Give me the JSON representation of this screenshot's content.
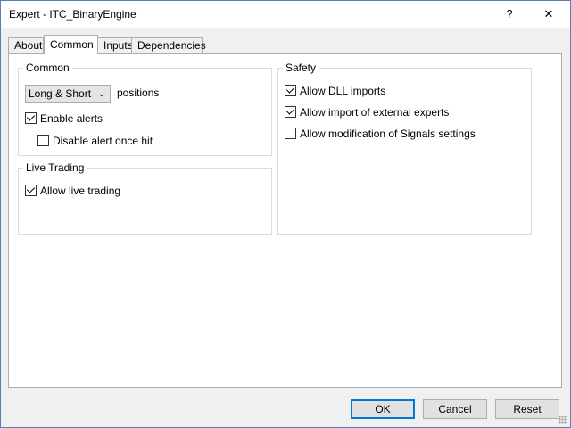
{
  "window": {
    "title": "Expert - ITC_BinaryEngine",
    "help_label": "?",
    "close_label": "✕"
  },
  "tabs": [
    {
      "label": "About",
      "active": false
    },
    {
      "label": "Common",
      "active": true
    },
    {
      "label": "Inputs",
      "active": false
    },
    {
      "label": "Dependencies",
      "active": false
    }
  ],
  "common": {
    "legend": "Common",
    "positions_select": "Long & Short",
    "positions_label": "positions",
    "enable_alerts": {
      "label": "Enable alerts",
      "checked": true
    },
    "disable_alert_once_hit": {
      "label": "Disable alert once hit",
      "checked": false
    }
  },
  "live_trading": {
    "legend": "Live Trading",
    "allow_live_trading": {
      "label": "Allow live trading",
      "checked": true
    }
  },
  "safety": {
    "legend": "Safety",
    "allow_dll": {
      "label": "Allow DLL imports",
      "checked": true
    },
    "allow_import_external": {
      "label": "Allow import of external experts",
      "checked": true
    },
    "allow_modification_signals": {
      "label": "Allow modification of Signals settings",
      "checked": false
    }
  },
  "buttons": {
    "ok": "OK",
    "cancel": "Cancel",
    "reset": "Reset"
  }
}
